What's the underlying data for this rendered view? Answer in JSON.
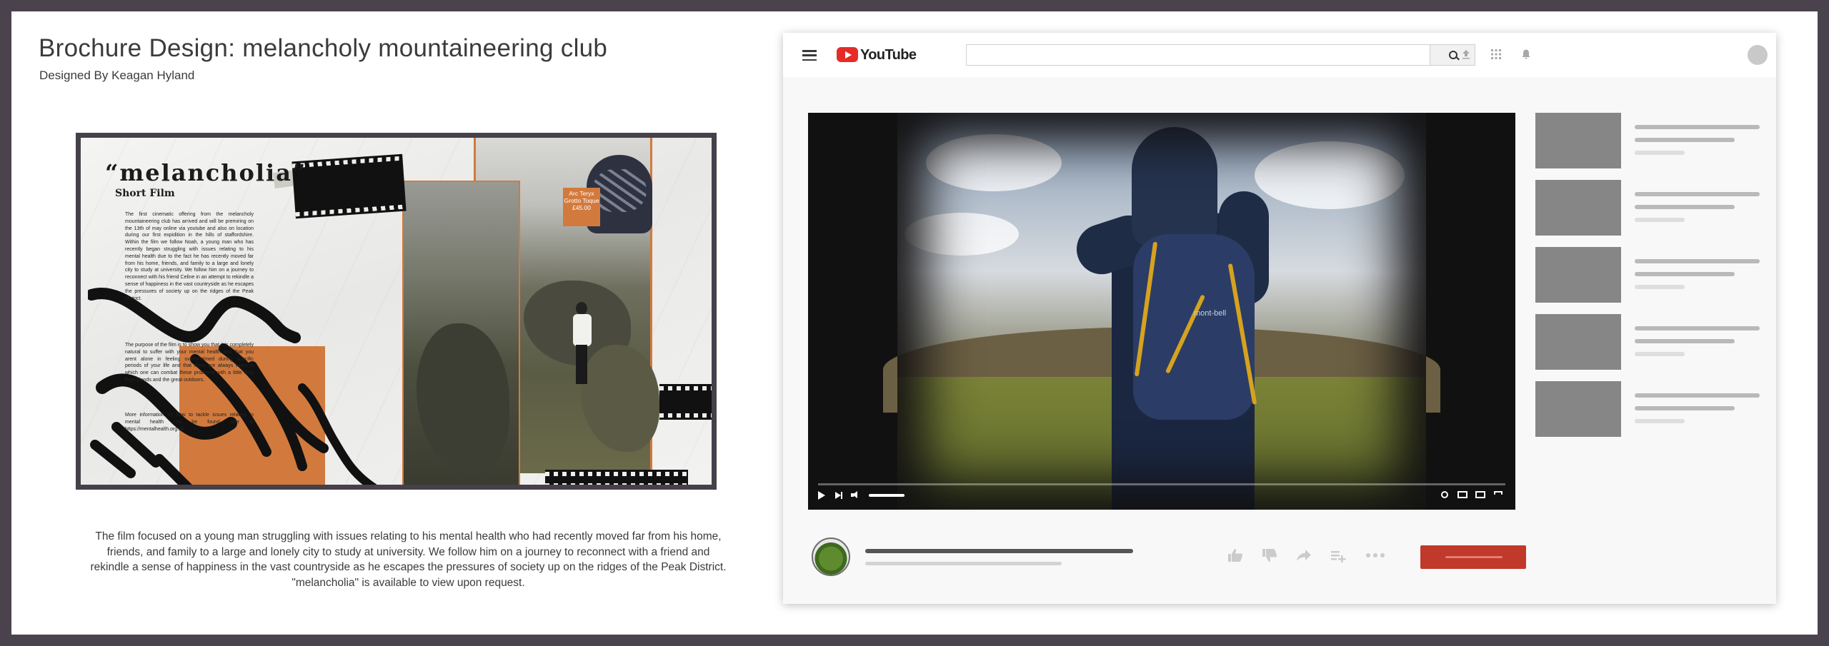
{
  "page": {
    "title": "Brochure Design: melancholy mountaineering club",
    "subtitle": "Designed By Keagan Hyland",
    "caption": "The film focused on a young man struggling with issues relating to his mental health who had recently moved far from his home, friends, and family to a large and lonely city to study at university. We follow him on a journey to reconnect with a friend and rekindle a sense of happiness in the vast countryside as he escapes the pressures of society up on the ridges of the Peak District. \"melancholia\" is available to view upon request."
  },
  "brochure": {
    "heading": "“melancholia”",
    "subheading": "Short Film",
    "paragraph1": "The first cinematic offering from the melancholy mountaineering club has arrived and will be premiring on the 13th of may online via youtube and also on location during our first expidition in the hills of staffordshire. Within the film we follow Noah, a young man who has recently began struggling with issues relating to his mental health due to the fact he has recently moved far from his home, friends, and family to a large and lonely city to study at university. We follow him on a journey to reconnect with his friend Celine in an attempt to rekindle a sense of happiness in the vast countryside as he escapes the pressures of society up on the ridges of the Peak District.",
    "paragraph2": "The purpose of the film is to show you that it is completely natural to suffer with your mental health and that you arent alone in feeling overwhelmed during specific periods of your life and that there are always ways in which one can combat these problems with a little help from friends and the great outdoors.",
    "paragraph3": "More information on how to tackle issues relating to mental health can be found over at https://mentalhealth.org.uk",
    "tag_text": "Arc Teryx Grotto Toque £45.00"
  },
  "youtube": {
    "logo_text": "YouTube",
    "search_placeholder": "",
    "pack_logo": "mont-bell",
    "colors": {
      "brand_red": "#e52d27",
      "subscribe_red": "#c0392b",
      "accent_orange": "#d27a3d"
    },
    "header_icons": [
      "upload-icon",
      "apps-icon",
      "bell-icon"
    ],
    "action_icons": [
      "like-icon",
      "dislike-icon",
      "share-icon",
      "add-to-playlist-icon",
      "more-icon"
    ],
    "player_icons": [
      "play-icon",
      "next-icon",
      "volume-icon",
      "settings-icon",
      "miniplayer-icon",
      "theater-icon",
      "fullscreen-icon"
    ]
  }
}
